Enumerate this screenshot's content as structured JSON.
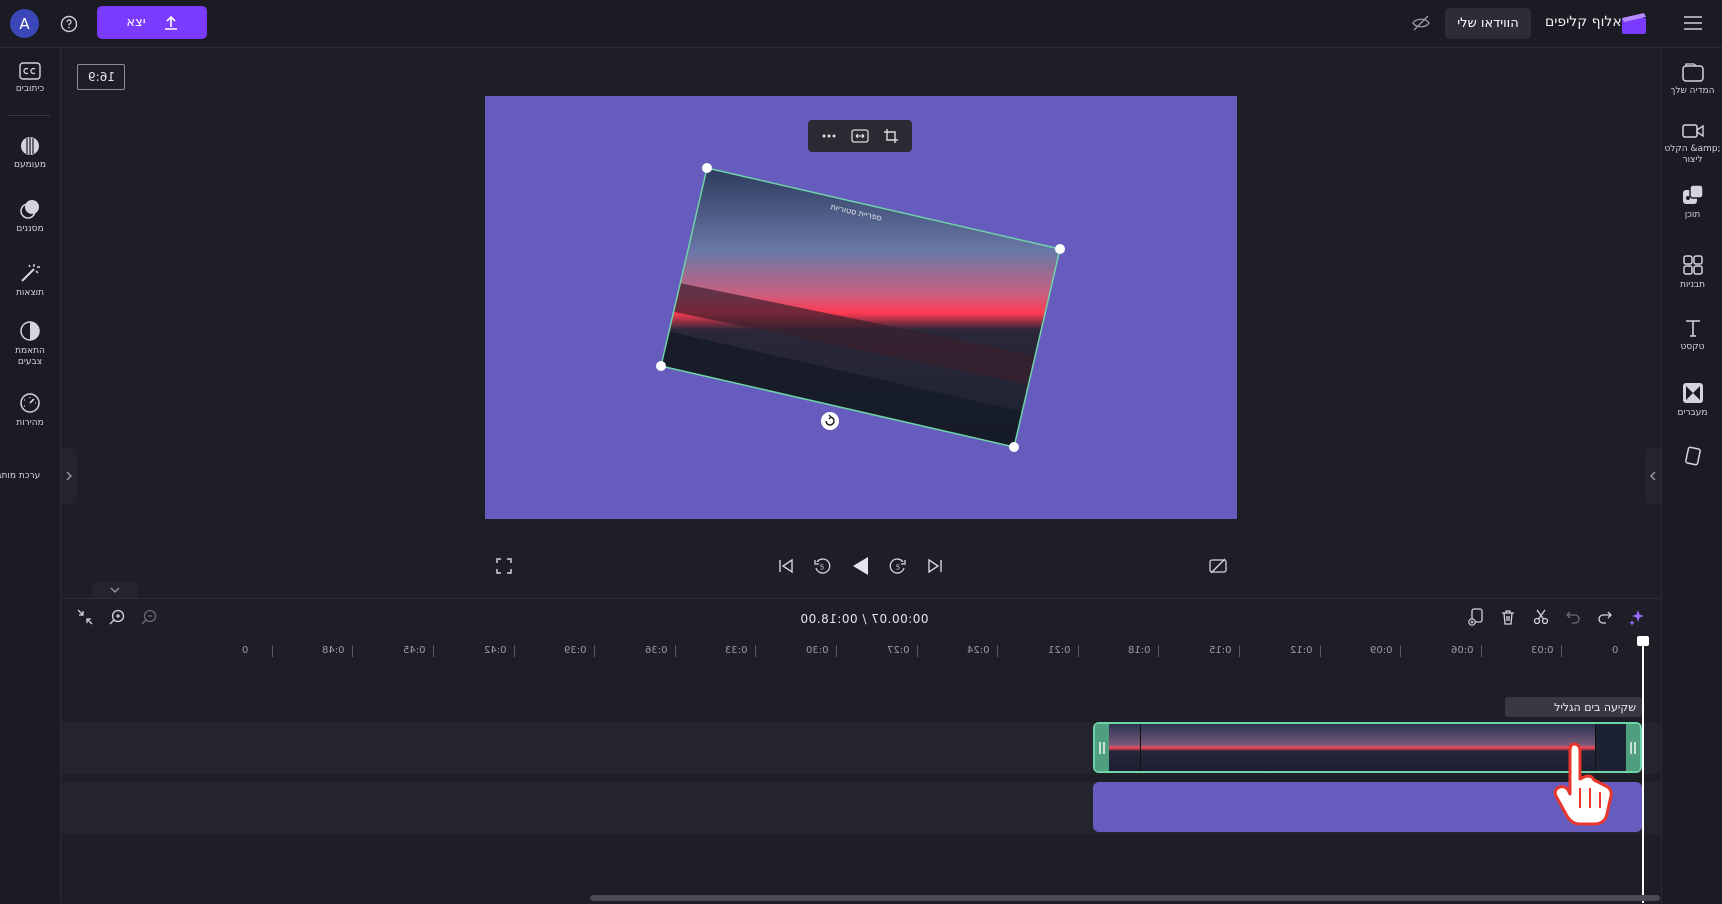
{
  "topbar": {
    "avatar_letter": "A",
    "export_label": "יצא",
    "my_videos_label": "הווידאו שלי",
    "brand_name": "אלוף קליפים"
  },
  "left_sidebar": {
    "items": [
      {
        "label": "כיתובים",
        "icon": "captions-icon"
      },
      {
        "label": "מעומעם",
        "icon": "fade-icon"
      },
      {
        "label": "מסננים",
        "icon": "filters-icon"
      },
      {
        "label": "תוצאות",
        "icon": "effects-icon"
      },
      {
        "label": "התאמת צבעים",
        "icon": "color-adjust-icon"
      },
      {
        "label": "מהירות",
        "icon": "speed-icon"
      },
      {
        "label": "ערכת מותג",
        "icon": "brand-kit-icon"
      }
    ]
  },
  "right_sidebar": {
    "items": [
      {
        "label": "המדיה שלך",
        "icon": "media-icon"
      },
      {
        "label": "הקלט &amp; ליצור",
        "icon": "record-icon"
      },
      {
        "label": "תוכן",
        "icon": "content-icon"
      },
      {
        "label": "תבניות",
        "icon": "templates-icon"
      },
      {
        "label": "טקסט",
        "icon": "text-icon"
      },
      {
        "label": "מעברים",
        "icon": "transitions-icon"
      },
      {
        "label": "",
        "icon": "brand-icon"
      }
    ]
  },
  "stage": {
    "aspect_ratio": "16:9",
    "canvas_color": "#665cbe",
    "overlay_text": "ספריית סטוריות"
  },
  "timeline": {
    "time_readout": "00:00.07 / 00:18.00",
    "ruler_ticks": [
      "0",
      "0:03",
      "0:06",
      "0:09",
      "0:12",
      "0:15",
      "0:18",
      "0:21",
      "0:24",
      "0:27",
      "0:30",
      "0:33",
      "0:36",
      "0:39",
      "0:42",
      "0:45",
      "0:48",
      "0"
    ],
    "video_track_label": "שקיעה בים הגליל",
    "background_clip_color": "#665cbe",
    "accent_color": "#7b3bff"
  }
}
